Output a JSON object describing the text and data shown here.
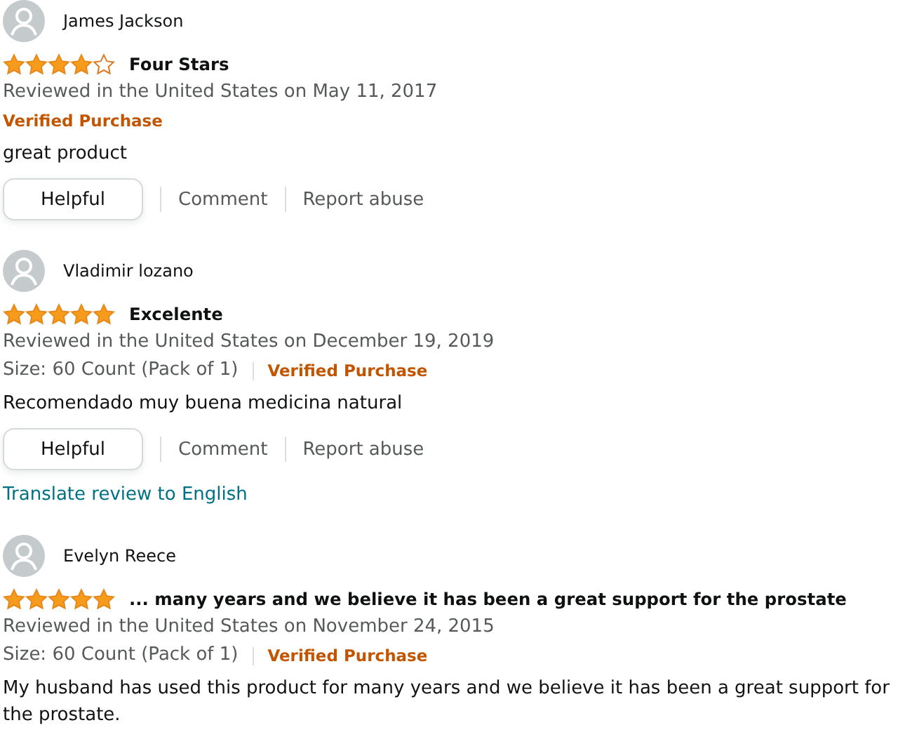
{
  "reviews": [
    {
      "name": "James Jackson",
      "stars": 4,
      "title": "Four Stars",
      "date_line": "Reviewed in the United States on May 11, 2017",
      "verified": "Verified Purchase",
      "body": "great product",
      "actions": {
        "helpful": "Helpful",
        "comment": "Comment",
        "report": "Report abuse"
      }
    },
    {
      "name": "Vladimir lozano",
      "stars": 5,
      "title": "Excelente",
      "date_line": "Reviewed in the United States on December 19, 2019",
      "size": "Size: 60 Count (Pack of 1)",
      "verified": "Verified Purchase",
      "body": "Recomendado muy buena medicina natural",
      "actions": {
        "helpful": "Helpful",
        "comment": "Comment",
        "report": "Report abuse"
      },
      "translate": "Translate review to English"
    },
    {
      "name": "Evelyn Reece",
      "stars": 5,
      "title": "... many years and we believe it has been a great support for the prostate",
      "date_line": "Reviewed in the United States on November 24, 2015",
      "size": "Size: 60 Count (Pack of 1)",
      "verified": "Verified Purchase",
      "body": "My husband has used this product for many years and we believe it has been a great support for the prostate."
    }
  ]
}
